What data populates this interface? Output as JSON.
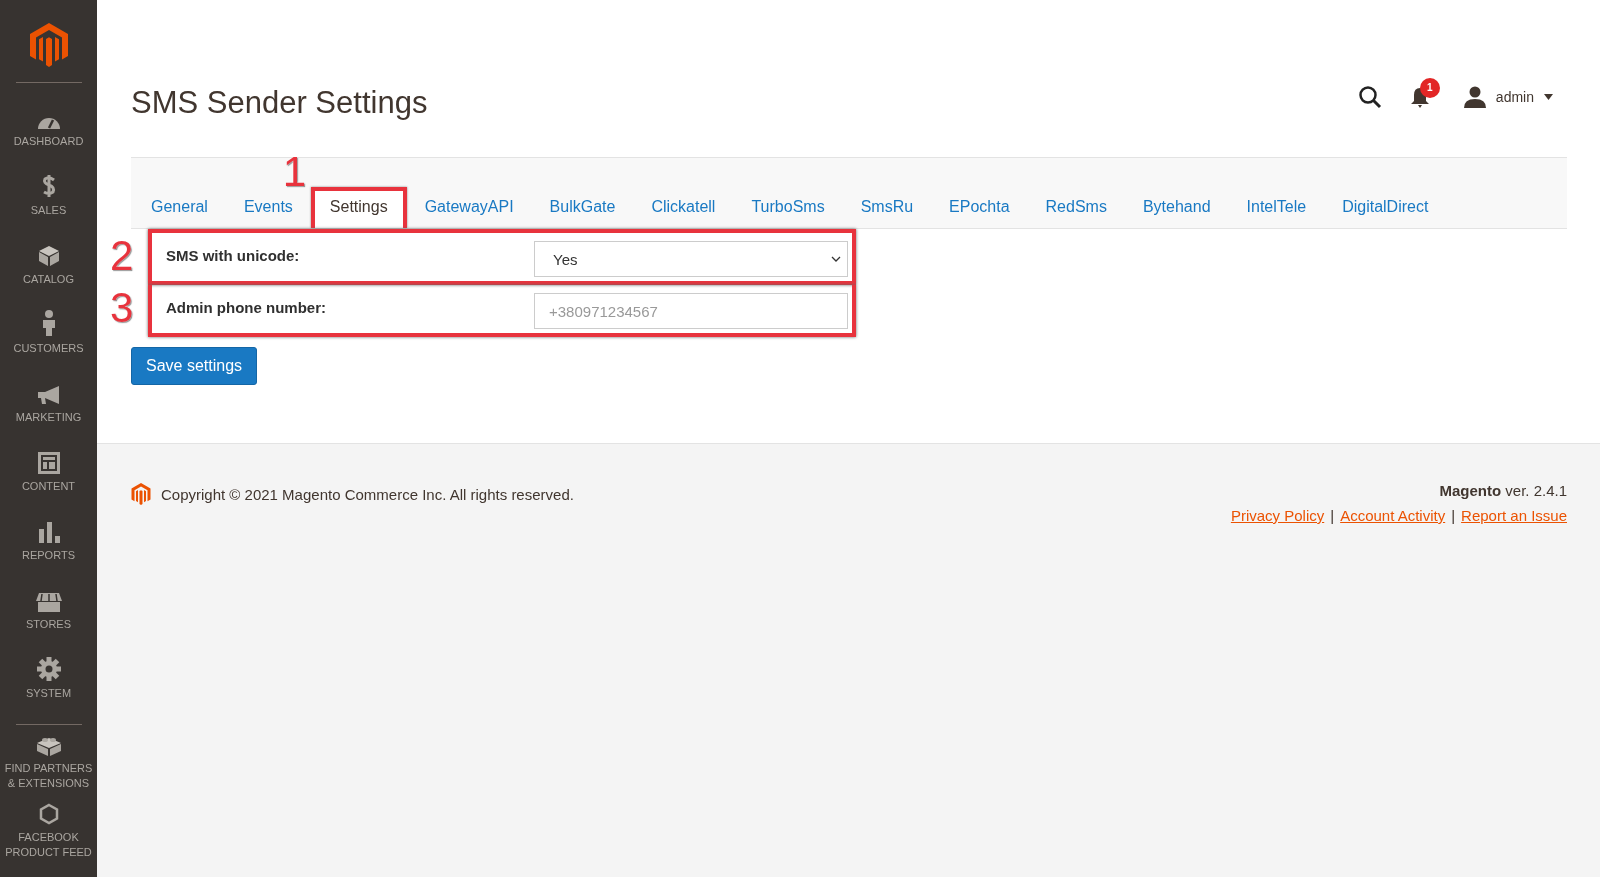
{
  "sidebar": {
    "items": [
      {
        "label": "DASHBOARD"
      },
      {
        "label": "SALES"
      },
      {
        "label": "CATALOG"
      },
      {
        "label": "CUSTOMERS"
      },
      {
        "label": "MARKETING"
      },
      {
        "label": "CONTENT"
      },
      {
        "label": "REPORTS"
      },
      {
        "label": "STORES"
      },
      {
        "label": "SYSTEM"
      }
    ],
    "extra_items": [
      {
        "label": "FIND PARTNERS & EXTENSIONS"
      },
      {
        "label": "FACEBOOK PRODUCT FEED"
      }
    ]
  },
  "header": {
    "title": "SMS Sender Settings",
    "notifications_count": "1",
    "user": "admin"
  },
  "tabs": [
    {
      "label": "General",
      "selected": false
    },
    {
      "label": "Events",
      "selected": false
    },
    {
      "label": "Settings",
      "selected": true,
      "callout": "1"
    },
    {
      "label": "GatewayAPI",
      "selected": false
    },
    {
      "label": "BulkGate",
      "selected": false
    },
    {
      "label": "Clickatell",
      "selected": false
    },
    {
      "label": "TurboSms",
      "selected": false
    },
    {
      "label": "SmsRu",
      "selected": false
    },
    {
      "label": "EPochta",
      "selected": false
    },
    {
      "label": "RedSms",
      "selected": false
    },
    {
      "label": "Bytehand",
      "selected": false
    },
    {
      "label": "IntelTele",
      "selected": false
    },
    {
      "label": "DigitalDirect",
      "selected": false
    }
  ],
  "fields": [
    {
      "kind": "select",
      "label": "SMS with unicode:",
      "value": "Yes",
      "callout": "2"
    },
    {
      "kind": "text",
      "label": "Admin phone number:",
      "placeholder": "+380971234567",
      "callout": "3"
    }
  ],
  "save_button": "Save settings",
  "footer": {
    "copyright": "Copyright © 2021 Magento Commerce Inc. All rights reserved.",
    "version": "**Magento** ver. 2.4.1",
    "links": [
      "Privacy Policy",
      "Account Activity",
      "Report an Issue"
    ],
    "separator": "|"
  }
}
